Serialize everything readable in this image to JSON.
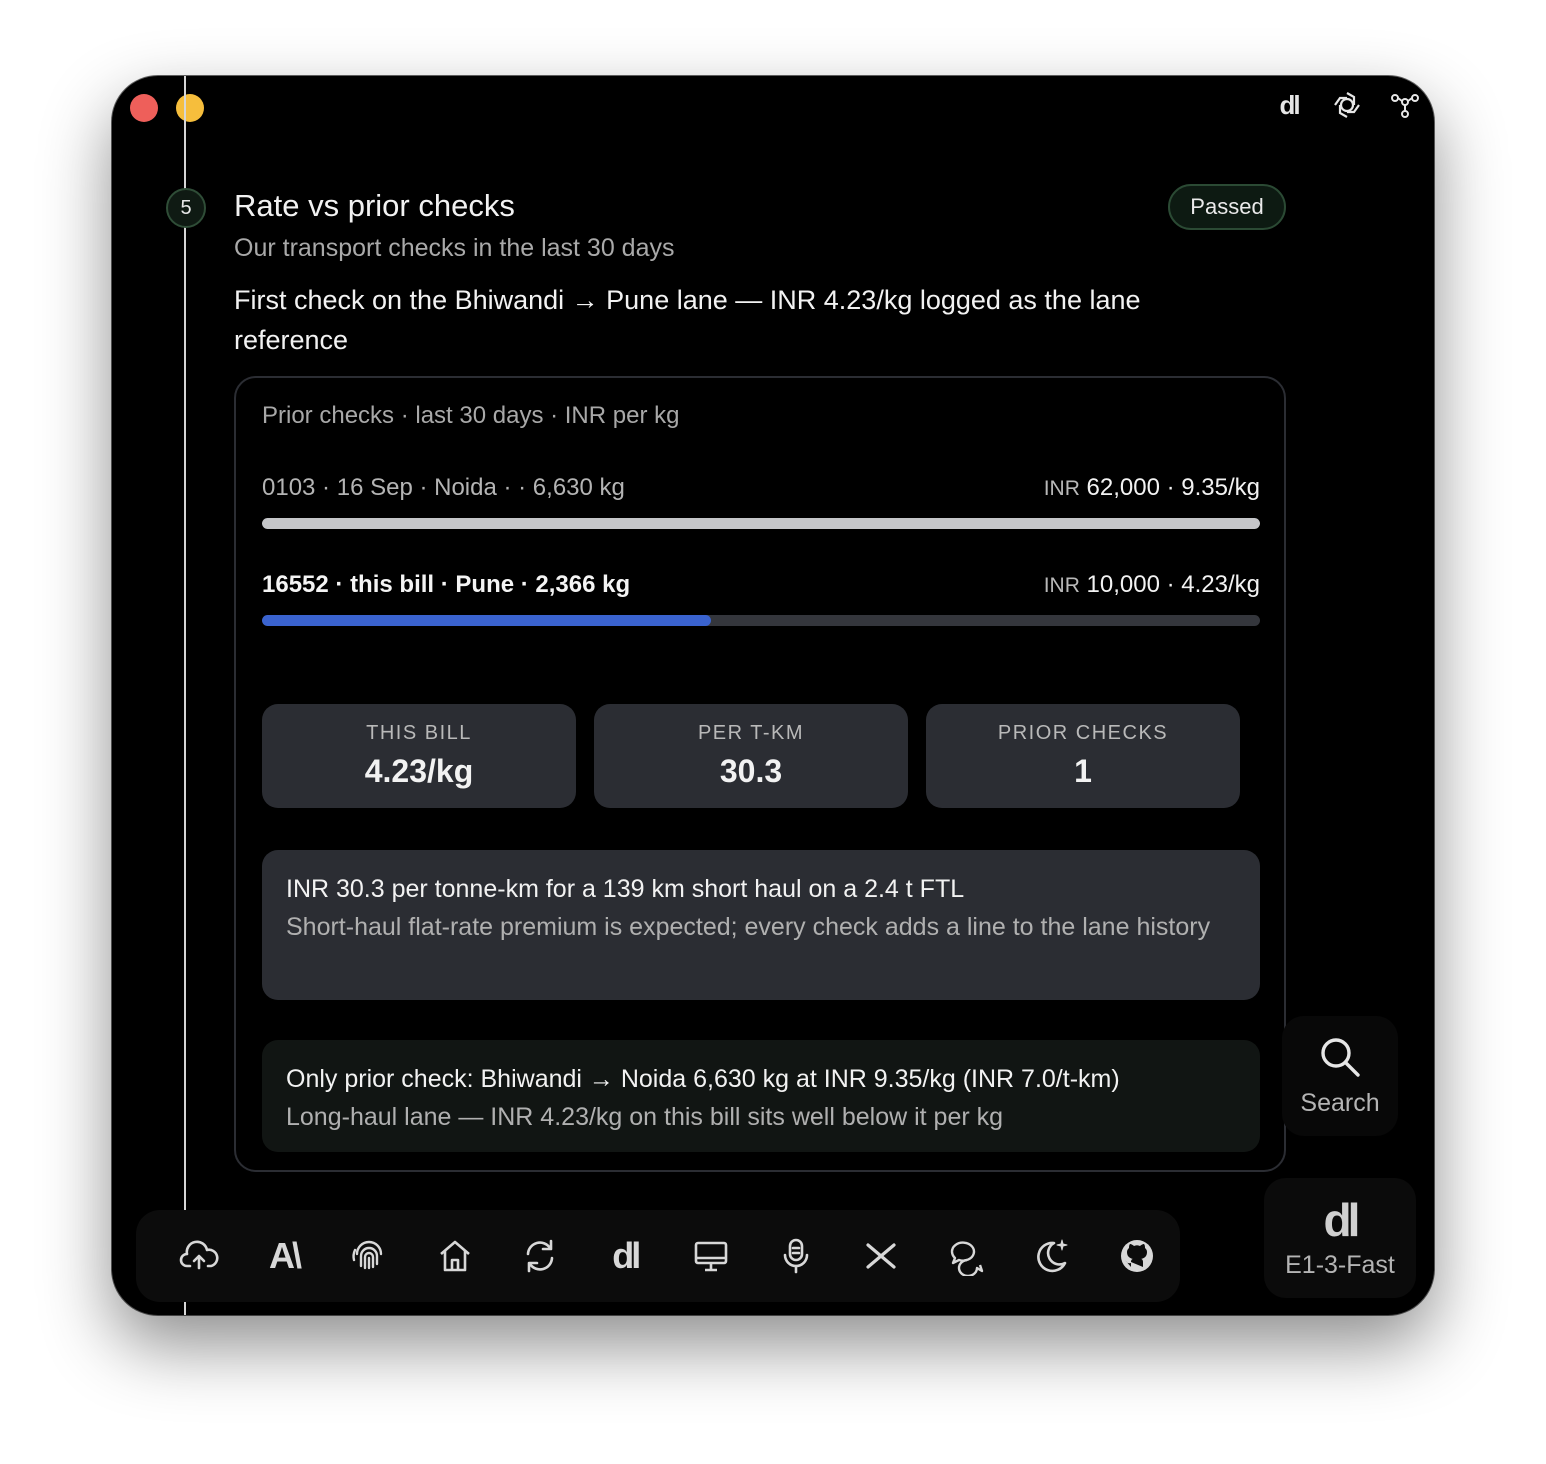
{
  "window": {
    "top_icons": [
      "dl-logo-icon",
      "openai-icon",
      "graph-nodes-icon"
    ],
    "top_logo_text": "dl"
  },
  "step": {
    "number": "5",
    "title": "Rate vs prior checks",
    "subtitle": "Our transport checks in the last 30 days",
    "status": "Passed",
    "status_color": "#2b4a34",
    "headline": "First check on the Bhiwandi → Pune lane — INR 4.23/kg logged as the lane reference"
  },
  "card": {
    "label": "Prior checks · last 30 days · INR per kg",
    "rows": [
      {
        "left": "0103 · 16 Sep · Noida · · 6,630 kg",
        "currency": "INR",
        "right": "62,000 · 9.35/kg",
        "bar_fraction": 1.0,
        "bar_color": "#c5c6c9",
        "highlight": false
      },
      {
        "left": "16552 · this bill · Pune · 2,366 kg",
        "currency": "INR",
        "right": "10,000 · 4.23/kg",
        "bar_fraction": 0.45,
        "bar_color": "#3a63cf",
        "highlight": true
      }
    ],
    "stats": [
      {
        "label": "THIS BILL",
        "value": "4.23/kg"
      },
      {
        "label": "PER T-KM",
        "value": "30.3"
      },
      {
        "label": "PRIOR CHECKS",
        "value": "1"
      }
    ],
    "notes": [
      {
        "title": "INR 30.3 per tonne-km for a 139 km short haul on a 2.4 t FTL",
        "text": "Short-haul flat-rate premium is expected; every check adds a line to the lane history"
      },
      {
        "title": "Only prior check: Bhiwandi → Noida 6,630 kg at INR 9.35/kg (INR 7.0/t-km)",
        "text": "Long-haul lane — INR 4.23/kg on this bill sits well below it per kg"
      }
    ]
  },
  "search": {
    "label": "Search",
    "icon": "search-icon"
  },
  "model": {
    "logo": "dl",
    "label": "E1-3-Fast"
  },
  "dock": {
    "items": [
      "cloud-upload-icon",
      "font-ai-icon",
      "fingerprint-icon",
      "home-icon",
      "refresh-icon",
      "dl-logo-icon",
      "desktop-icon",
      "microphone-icon",
      "x-icon",
      "chat-bubbles-icon",
      "moon-sparkle-icon",
      "github-icon"
    ],
    "dl_text": "dl",
    "font_text": "A\\"
  }
}
